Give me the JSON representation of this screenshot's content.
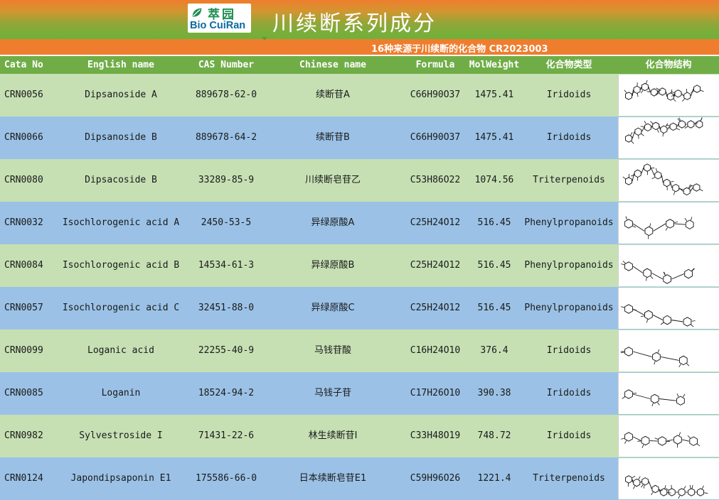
{
  "brand": {
    "logo_cn": "萃园",
    "logo_en": "Bio CuiRan",
    "leaf_color": "#1f8f52",
    "en_color": "#0a6a9e"
  },
  "title": "川续断系列成分",
  "subtitle": "16种来源于川续断的化合物   CR2023003",
  "colors": {
    "header_bg": "#70ad47",
    "row_green": "#c6e0b4",
    "row_blue": "#9bc2e6",
    "banner_orange": "#ef7d2e"
  },
  "columns": [
    "Cata No",
    "English name",
    "CAS Number",
    "Chinese name",
    "Formula",
    "MolWeight",
    "化合物类型",
    "化合物结构"
  ],
  "rows": [
    {
      "cata": "CRN0056",
      "en": "Dipsanoside A",
      "cas": "889678-62-0",
      "cn": "续断苷A",
      "formula": "C66H90O37",
      "mw": "1475.41",
      "type": "Iridoids",
      "structure": "structure-icon"
    },
    {
      "cata": "CRN0066",
      "en": "Dipsanoside B",
      "cas": "889678-64-2",
      "cn": "续断苷B",
      "formula": "C66H90O37",
      "mw": "1475.41",
      "type": "Iridoids",
      "structure": "structure-icon"
    },
    {
      "cata": "CRN0080",
      "en": "Dipsacoside B",
      "cas": "33289-85-9",
      "cn": "川续断皂苷乙",
      "formula": "C53H86O22",
      "mw": "1074.56",
      "type": "Triterpenoids",
      "structure": "structure-icon"
    },
    {
      "cata": "CRN0032",
      "en": "Isochlorogenic acid A",
      "cas": "2450-53-5",
      "cn": "异绿原酸A",
      "formula": "C25H24O12",
      "mw": "516.45",
      "type": "Phenylpropanoids",
      "structure": "structure-icon"
    },
    {
      "cata": "CRN0084",
      "en": "Isochlorogenic acid B",
      "cas": "14534-61-3",
      "cn": "异绿原酸B",
      "formula": "C25H24O12",
      "mw": "516.45",
      "type": "Phenylpropanoids",
      "structure": "structure-icon"
    },
    {
      "cata": "CRN0057",
      "en": "Isochlorogenic acid C",
      "cas": "32451-88-0",
      "cn": "异绿原酸C",
      "formula": "C25H24O12",
      "mw": "516.45",
      "type": "Phenylpropanoids",
      "structure": "structure-icon"
    },
    {
      "cata": "CRN0099",
      "en": "Loganic acid",
      "cas": "22255-40-9",
      "cn": "马钱苷酸",
      "formula": "C16H24O10",
      "mw": "376.4",
      "type": "Iridoids",
      "structure": "structure-icon"
    },
    {
      "cata": "CRN0085",
      "en": "Loganin",
      "cas": "18524-94-2",
      "cn": "马钱子苷",
      "formula": "C17H26O10",
      "mw": "390.38",
      "type": "Iridoids",
      "structure": "structure-icon"
    },
    {
      "cata": "CRN0982",
      "en": "Sylvestroside I",
      "cas": "71431-22-6",
      "cn": "林生续断苷Ⅰ",
      "formula": "C33H48O19",
      "mw": "748.72",
      "type": "Iridoids",
      "structure": "structure-icon"
    },
    {
      "cata": "CRN0124",
      "en": "Japondipsaponin E1",
      "cas": "175586-66-0",
      "cn": "日本续断皂苷E1",
      "formula": "C59H96O26",
      "mw": "1221.4",
      "type": "Triterpenoids",
      "structure": "structure-icon"
    }
  ]
}
